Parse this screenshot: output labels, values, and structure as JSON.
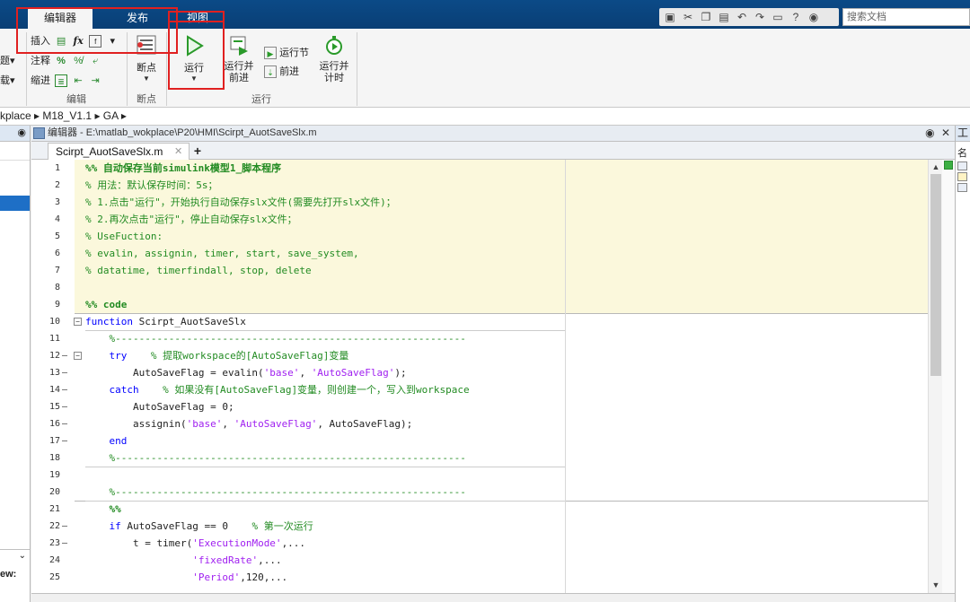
{
  "tabs": [
    {
      "label": "编辑器",
      "active": true
    },
    {
      "label": "发布",
      "active": false
    },
    {
      "label": "视图",
      "active": false
    }
  ],
  "search": {
    "placeholder": "搜索文档"
  },
  "ribbon": {
    "left_rows": [
      "题▾",
      "载▾"
    ],
    "edit_group": {
      "label": "编辑",
      "rows": [
        {
          "label": "插入",
          "icons": [
            "comment-icon",
            "fx-icon",
            "function-icon"
          ]
        },
        {
          "label": "注释",
          "icons": [
            "percent-icon",
            "percent-strike-icon",
            "wrap-icon"
          ]
        },
        {
          "label": "缩进",
          "icons": [
            "indent-icon",
            "indent-left-icon",
            "indent-right-icon"
          ]
        }
      ]
    },
    "breakpoint_group": {
      "label": "断点",
      "button": "断点"
    },
    "run_group": {
      "label": "运行",
      "run": "运行",
      "run_advance": [
        "运行并",
        "前进"
      ],
      "run_section": "运行节",
      "advance": "前进",
      "run_time": [
        "运行并",
        "计时"
      ]
    }
  },
  "breadcrumb": {
    "path": [
      "kplace",
      "M18_V1.1",
      "GA"
    ]
  },
  "left_panel": {
    "view_label": "ew:"
  },
  "editor": {
    "title": "编辑器 - E:\\matlab_wokplace\\P20\\HMI\\Scirpt_AuotSaveSlx.m",
    "file_tab": "Scirpt_AuotSaveSlx.m",
    "add_tab": "+"
  },
  "right_panel": {
    "header": "工",
    "sub": "名"
  },
  "colors": {
    "accent": "#0b4a87",
    "highlight": "#e02020",
    "comment": "#228b22",
    "keyword": "#0000ff",
    "string": "#a020f0",
    "cell_bg": "#fbf8dc"
  },
  "code_lines": [
    {
      "n": "1",
      "dash": false,
      "parts": [
        {
          "t": "%% 自动保存当前simulink模型1_脚本程序",
          "c": "c b"
        }
      ]
    },
    {
      "n": "2",
      "dash": false,
      "parts": [
        {
          "t": "% 用法：默认保存时间：5s；",
          "c": "c"
        }
      ]
    },
    {
      "n": "3",
      "dash": false,
      "parts": [
        {
          "t": "% 1.点击\"运行\"，开始执行自动保存slx文件(需要先打开slx文件)；",
          "c": "c"
        }
      ]
    },
    {
      "n": "4",
      "dash": false,
      "parts": [
        {
          "t": "% 2.再次点击\"运行\"，停止自动保存slx文件；",
          "c": "c"
        }
      ]
    },
    {
      "n": "5",
      "dash": false,
      "parts": [
        {
          "t": "% UseFuction:",
          "c": "c"
        }
      ]
    },
    {
      "n": "6",
      "dash": false,
      "parts": [
        {
          "t": "% evalin, assignin, timer, start, save_system,",
          "c": "c"
        }
      ]
    },
    {
      "n": "7",
      "dash": false,
      "parts": [
        {
          "t": "% datatime, timerfindall, stop, delete",
          "c": "c"
        }
      ]
    },
    {
      "n": "8",
      "dash": false,
      "parts": [
        {
          "t": "",
          "c": ""
        }
      ]
    },
    {
      "n": "9",
      "dash": false,
      "parts": [
        {
          "t": "%% code",
          "c": "c b"
        }
      ]
    },
    {
      "n": "10",
      "dash": false,
      "fold": "−",
      "parts": [
        {
          "t": "function",
          "c": "k"
        },
        {
          "t": " Scirpt_AuotSaveSlx",
          "c": ""
        }
      ]
    },
    {
      "n": "11",
      "dash": false,
      "parts": [
        {
          "t": "    %-----------------------------------------------------------",
          "c": "c"
        }
      ]
    },
    {
      "n": "12",
      "dash": true,
      "fold": "−",
      "parts": [
        {
          "t": "    try",
          "c": "k"
        },
        {
          "t": "    % 提取workspace的[AutoSaveFlag]变量",
          "c": "c"
        }
      ]
    },
    {
      "n": "13",
      "dash": true,
      "parts": [
        {
          "t": "        AutoSaveFlag = evalin(",
          "c": ""
        },
        {
          "t": "'base'",
          "c": "s"
        },
        {
          "t": ", ",
          "c": ""
        },
        {
          "t": "'AutoSaveFlag'",
          "c": "s"
        },
        {
          "t": ");",
          "c": ""
        }
      ]
    },
    {
      "n": "14",
      "dash": true,
      "parts": [
        {
          "t": "    catch",
          "c": "k"
        },
        {
          "t": "    % 如果没有[AutoSaveFlag]变量，则创建一个，写入到workspace",
          "c": "c"
        }
      ]
    },
    {
      "n": "15",
      "dash": true,
      "parts": [
        {
          "t": "        AutoSaveFlag = 0;",
          "c": ""
        }
      ]
    },
    {
      "n": "16",
      "dash": true,
      "parts": [
        {
          "t": "        assignin(",
          "c": ""
        },
        {
          "t": "'base'",
          "c": "s"
        },
        {
          "t": ", ",
          "c": ""
        },
        {
          "t": "'AutoSaveFlag'",
          "c": "s"
        },
        {
          "t": ", AutoSaveFlag);",
          "c": ""
        }
      ]
    },
    {
      "n": "17",
      "dash": true,
      "parts": [
        {
          "t": "    end",
          "c": "k"
        }
      ]
    },
    {
      "n": "18",
      "dash": false,
      "parts": [
        {
          "t": "    %-----------------------------------------------------------",
          "c": "c"
        }
      ]
    },
    {
      "n": "19",
      "dash": false,
      "parts": [
        {
          "t": "",
          "c": ""
        }
      ]
    },
    {
      "n": "20",
      "dash": false,
      "parts": [
        {
          "t": "    %-----------------------------------------------------------",
          "c": "c"
        }
      ]
    },
    {
      "n": "21",
      "dash": false,
      "parts": [
        {
          "t": "    %%",
          "c": "c b"
        }
      ]
    },
    {
      "n": "22",
      "dash": true,
      "parts": [
        {
          "t": "    if",
          "c": "k"
        },
        {
          "t": " AutoSaveFlag == 0    ",
          "c": ""
        },
        {
          "t": "% 第一次运行",
          "c": "c"
        }
      ]
    },
    {
      "n": "23",
      "dash": true,
      "parts": [
        {
          "t": "        t = timer(",
          "c": ""
        },
        {
          "t": "'ExecutionMode'",
          "c": "s"
        },
        {
          "t": ",...",
          "c": ""
        }
      ]
    },
    {
      "n": "24",
      "dash": false,
      "parts": [
        {
          "t": "                  ",
          "c": ""
        },
        {
          "t": "'fixedRate'",
          "c": "s"
        },
        {
          "t": ",...",
          "c": ""
        }
      ]
    },
    {
      "n": "25",
      "dash": false,
      "parts": [
        {
          "t": "                  ",
          "c": ""
        },
        {
          "t": "'Period'",
          "c": "s"
        },
        {
          "t": ",120,...",
          "c": ""
        }
      ]
    }
  ]
}
